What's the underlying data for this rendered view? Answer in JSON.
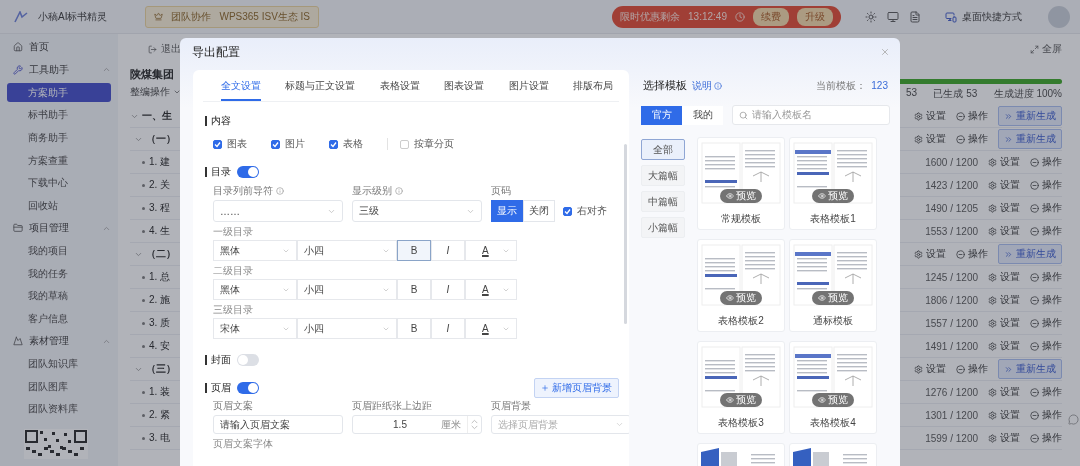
{
  "topbar": {
    "logo": "小稿AI标书精灵",
    "team": "团队协作",
    "ecosystem": "WPS365 ISV生态 IS",
    "promo": {
      "label": "限时优惠剩余",
      "timer": "13:12:49",
      "buttons": [
        "续费",
        "升级"
      ]
    },
    "shortcut": "桌面快捷方式"
  },
  "sidebar": {
    "items": [
      {
        "label": "首页"
      },
      {
        "label": "工具助手",
        "expanded": true,
        "children": [
          {
            "label": "方案助手",
            "selected": true
          },
          {
            "label": "标书助手",
            "selected": false
          },
          {
            "label": "商务助手",
            "selected": false
          },
          {
            "label": "方案查重",
            "selected": false
          },
          {
            "label": "下载中心",
            "selected": false
          },
          {
            "label": "回收站",
            "selected": false
          }
        ]
      },
      {
        "label": "项目管理",
        "expanded": true,
        "children": [
          {
            "label": "我的项目",
            "selected": false
          },
          {
            "label": "我的任务",
            "selected": false
          },
          {
            "label": "我的草稿",
            "selected": false
          },
          {
            "label": "客户信息",
            "selected": false
          }
        ]
      },
      {
        "label": "素材管理",
        "expanded": true,
        "children": [
          {
            "label": "团队知识库",
            "selected": false
          },
          {
            "label": "团队图库",
            "selected": false
          },
          {
            "label": "团队资料库",
            "selected": false
          }
        ]
      }
    ]
  },
  "document": {
    "exit": "退出",
    "title": "陕煤集团",
    "operation": "整编操作",
    "fullscreen": "全屏",
    "progress": {
      "level": 1
    },
    "stats": [
      "53",
      "已生成 53",
      "生成进度 100%"
    ],
    "rows": [
      {
        "label": "一、生",
        "expanded": true,
        "actions": [
          "设置",
          "操作"
        ],
        "regenerate": "重新生成",
        "children": [
          {
            "label": "（一）",
            "expanded": true,
            "actions": [
              "设置",
              "操作"
            ],
            "regenerate": "重新生成",
            "children": [
              {
                "label": "1. 建",
                "count": "1600 / 1200",
                "actions": [
                  "设置",
                  "操作"
                ]
              },
              {
                "label": "2. 关",
                "count": "1423 / 1200",
                "actions": [
                  "设置",
                  "操作"
                ]
              },
              {
                "label": "3. 程",
                "count": "1490 / 1205",
                "actions": [
                  "设置",
                  "操作"
                ]
              },
              {
                "label": "4. 生",
                "count": "1553 / 1200",
                "actions": [
                  "设置",
                  "操作"
                ]
              }
            ]
          },
          {
            "label": "（二）",
            "expanded": true,
            "actions": [
              "设置",
              "操作"
            ],
            "regenerate": "重新生成",
            "children": [
              {
                "label": "1. 总",
                "count": "1245 / 1200",
                "actions": [
                  "设置",
                  "操作"
                ]
              },
              {
                "label": "2. 施",
                "count": "1806 / 1200",
                "actions": [
                  "设置",
                  "操作"
                ]
              },
              {
                "label": "3. 质",
                "count": "1557 / 1200",
                "actions": [
                  "设置",
                  "操作"
                ]
              },
              {
                "label": "4. 安",
                "count": "1491 / 1200",
                "actions": [
                  "设置",
                  "操作"
                ]
              }
            ]
          },
          {
            "label": "（三）",
            "expanded": true,
            "actions": [
              "设置",
              "操作"
            ],
            "regenerate": "重新生成",
            "children": [
              {
                "label": "1. 装",
                "count": "1276 / 1200",
                "actions": [
                  "设置",
                  "操作"
                ]
              },
              {
                "label": "2. 紧",
                "count": "1301 / 1200",
                "actions": [
                  "设置",
                  "操作"
                ]
              },
              {
                "label": "3. 电",
                "count": "1599 / 1200",
                "actions": [
                  "设置",
                  "操作"
                ]
              }
            ]
          }
        ]
      }
    ]
  },
  "dialog": {
    "title": "导出配置",
    "tabs": [
      {
        "label": "全文设置",
        "selected": true
      },
      {
        "label": "标题与正文设置",
        "selected": false
      },
      {
        "label": "表格设置",
        "selected": false
      },
      {
        "label": "图表设置",
        "selected": false
      },
      {
        "label": "图片设置",
        "selected": false
      },
      {
        "label": "排版布局",
        "selected": false
      }
    ],
    "content": {
      "title": "内容",
      "options": [
        {
          "label": "图表",
          "checked": true
        },
        {
          "label": "图片",
          "checked": true
        },
        {
          "label": "表格",
          "checked": true
        },
        {
          "label": "按章分页",
          "checked": false
        }
      ]
    },
    "toc": {
      "title": "目录",
      "on": true,
      "leader": {
        "label": "目录列前导符",
        "value": "……"
      },
      "level": {
        "label": "显示级别",
        "value": "三级"
      },
      "page_number": {
        "label": "页码",
        "options": [
          {
            "label": "显示",
            "selected": true
          },
          {
            "label": "关闭",
            "selected": false
          }
        ],
        "right_align": {
          "label": "右对齐",
          "checked": true
        }
      },
      "levels": [
        {
          "label": "一级目录",
          "font": "黑体",
          "size": "小四",
          "bold": {
            "label": "B",
            "selected": true
          },
          "italic": "I",
          "text_tint": "A"
        },
        {
          "label": "二级目录",
          "font": "黑体",
          "size": "小四",
          "bold": {
            "label": "B",
            "selected": false
          },
          "italic": "I",
          "text_tint": "A"
        },
        {
          "label": "三级目录",
          "font": "宋体",
          "size": "小四",
          "bold": {
            "label": "B",
            "selected": false
          },
          "italic": "I",
          "text_tint": "A"
        }
      ]
    },
    "cover": {
      "title": "封面",
      "on": false
    },
    "header": {
      "title": "页眉",
      "on": true,
      "add_button": "新增页眉背景",
      "text": {
        "label": "页眉文案",
        "placeholder": "请输入页眉文案"
      },
      "margin": {
        "label": "页眉距纸张上边距",
        "value": "1.5",
        "unit": "厘米"
      },
      "background": {
        "label": "页眉背景",
        "placeholder": "选择页眉背景"
      },
      "next_label": "页眉文案字体"
    },
    "templates": {
      "title": "选择模板",
      "help": "说明",
      "current_label": "当前模板：",
      "current_value": "123",
      "sources": [
        {
          "label": "官方",
          "selected": true
        },
        {
          "label": "我的",
          "selected": false
        }
      ],
      "search_placeholder": "请输入模板名",
      "categories": [
        {
          "label": "全部",
          "selected": true
        },
        {
          "label": "大篇幅",
          "selected": false
        },
        {
          "label": "中篇幅",
          "selected": false
        },
        {
          "label": "小篇幅",
          "selected": false
        }
      ],
      "items": [
        {
          "kind": "full",
          "name": "常规模板",
          "preview": "预览"
        },
        {
          "kind": "full",
          "name": "表格模板1",
          "preview": "预览"
        },
        {
          "kind": "full",
          "name": "表格模板2",
          "preview": "预览"
        },
        {
          "kind": "full",
          "name": "通标模板",
          "preview": "预览"
        },
        {
          "kind": "full",
          "name": "表格模板3",
          "preview": "预览"
        },
        {
          "kind": "full",
          "name": "表格模板4",
          "preview": "预览"
        },
        {
          "kind": "partial"
        },
        {
          "kind": "partial"
        }
      ]
    }
  }
}
